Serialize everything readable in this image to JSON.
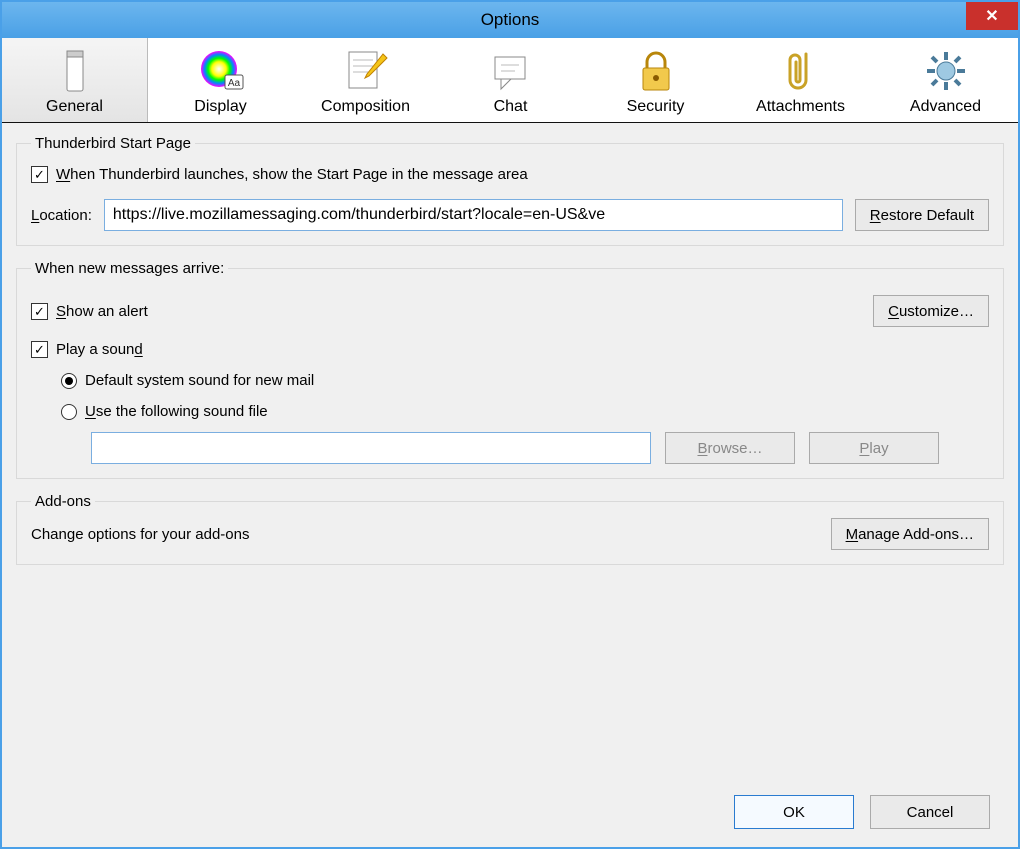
{
  "window": {
    "title": "Options"
  },
  "tabs": [
    {
      "label": "General"
    },
    {
      "label": "Display"
    },
    {
      "label": "Composition"
    },
    {
      "label": "Chat"
    },
    {
      "label": "Security"
    },
    {
      "label": "Attachments"
    },
    {
      "label": "Advanced"
    }
  ],
  "start_page": {
    "legend": "Thunderbird Start Page",
    "checkbox_pre": "W",
    "checkbox_post": "hen Thunderbird launches, show the Start Page in the message area",
    "location_pre": "L",
    "location_post": "ocation:",
    "url": "https://live.mozillamessaging.com/thunderbird/start?locale=en-US&ve",
    "restore_pre": "R",
    "restore_post": "estore Default"
  },
  "new_msgs": {
    "legend": "When new messages arrive:",
    "alert_pre": "S",
    "alert_post": "how an alert",
    "customize_pre": "C",
    "customize_post": "ustomize…",
    "play_pre": "Play a soun",
    "play_mne": "d",
    "radio_default": "Default system sound for new mail",
    "radio_file_pre": "U",
    "radio_file_post": "se the following sound file",
    "sound_path": "",
    "browse_pre": "B",
    "browse_post": "rowse…",
    "play_btn_pre": "P",
    "play_btn_post": "lay"
  },
  "addons": {
    "legend": "Add-ons",
    "desc": "Change options for your add-ons",
    "manage_pre": "M",
    "manage_post": "anage Add-ons…"
  },
  "footer": {
    "ok": "OK",
    "cancel": "Cancel"
  }
}
